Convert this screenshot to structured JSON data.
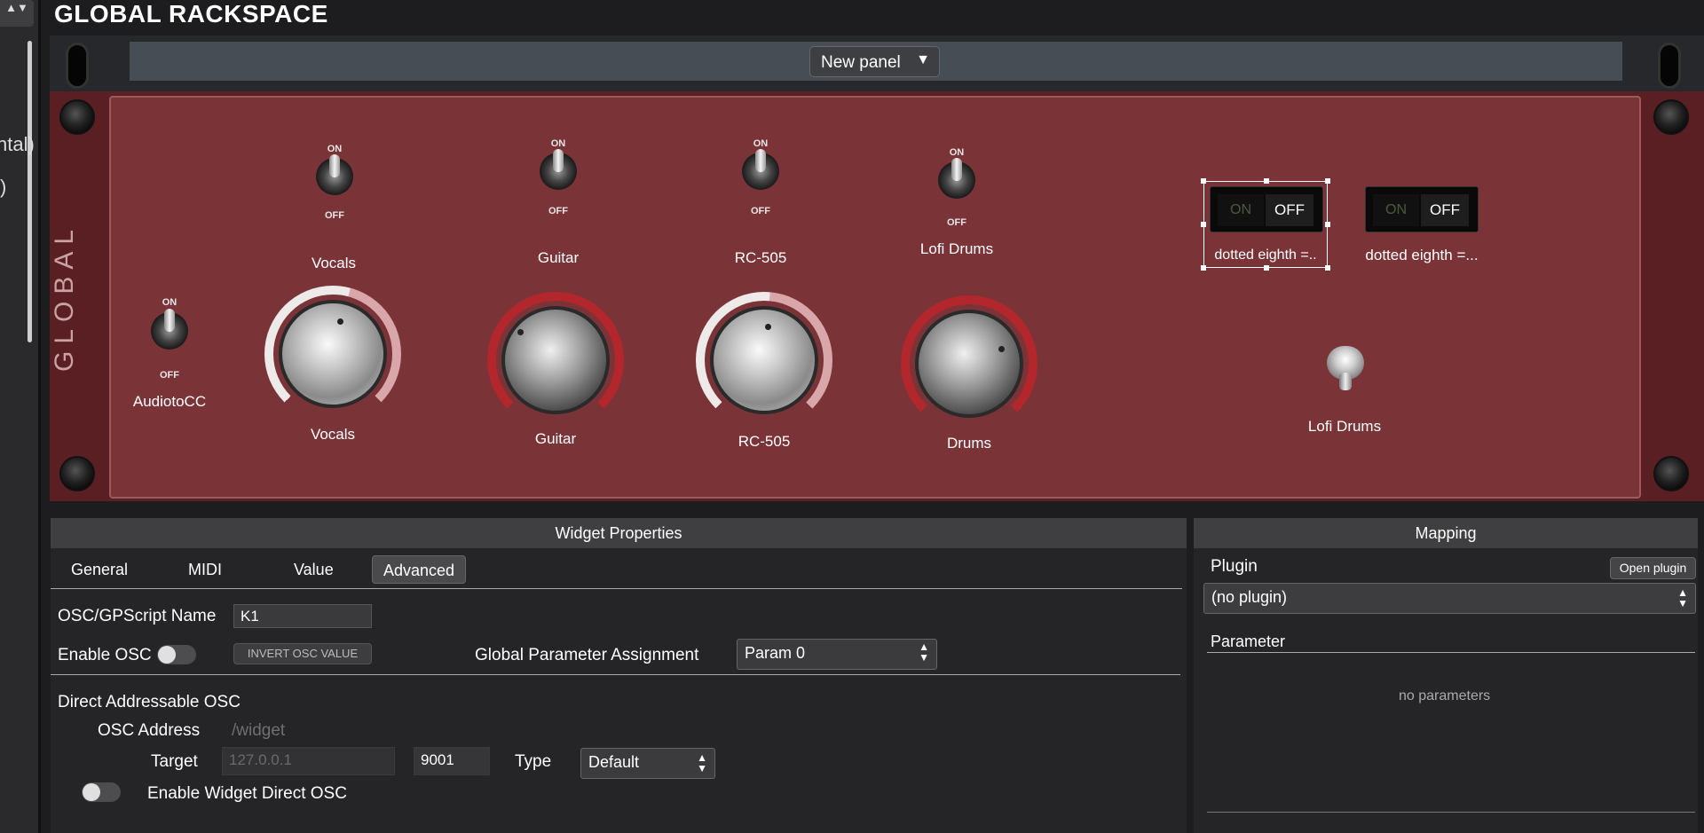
{
  "app_title": "GLOBAL RACKSPACE",
  "sidebar": {
    "arrows": "▲▼",
    "text1": "ntal)",
    "text2": ")"
  },
  "panel_selector": {
    "value": "New panel",
    "arrow": "▼"
  },
  "rack": {
    "side_label": "GLOBAL",
    "toggle_on": "ON",
    "toggle_off": "OFF",
    "switches": [
      {
        "label": "Vocals"
      },
      {
        "label": "Guitar"
      },
      {
        "label": "RC-505"
      },
      {
        "label": "Lofi Drums"
      },
      {
        "label": "AudiotoCC"
      },
      {
        "label": "Lofi Drums"
      }
    ],
    "knobs": [
      {
        "label": "Vocals",
        "style": "white"
      },
      {
        "label": "Guitar",
        "style": "red"
      },
      {
        "label": "RC-505",
        "style": "white"
      },
      {
        "label": "Drums",
        "style": "red"
      }
    ],
    "rockers": [
      {
        "on": "ON",
        "off": "OFF",
        "label": "dotted eighth =..",
        "selected": true
      },
      {
        "on": "ON",
        "off": "OFF",
        "label": "dotted eighth =...",
        "selected": false
      }
    ],
    "colors": {
      "rack_face": "#7a3438",
      "ring_red": "#b3262b",
      "ring_white": "#e9e2e2"
    }
  },
  "widget_properties": {
    "title": "Widget Properties",
    "tabs": [
      {
        "label": "General",
        "active": false
      },
      {
        "label": "MIDI",
        "active": false
      },
      {
        "label": "Value",
        "active": false
      },
      {
        "label": "Advanced",
        "active": true
      }
    ],
    "osc_name_label": "OSC/GPScript Name",
    "osc_name_value": "K1",
    "enable_osc_label": "Enable OSC",
    "invert_osc_label": "INVERT OSC VALUE",
    "global_param_label": "Global Parameter Assignment",
    "global_param_value": "Param 0",
    "direct_osc_heading": "Direct Addressable OSC",
    "osc_address_label": "OSC Address",
    "osc_address_value": "/widget",
    "target_label": "Target",
    "target_ip": "127.0.0.1",
    "target_port": "9001",
    "type_label": "Type",
    "type_value": "Default",
    "enable_direct_label": "Enable Widget Direct OSC"
  },
  "mapping": {
    "title": "Mapping",
    "plugin_label": "Plugin",
    "open_plugin": "Open plugin",
    "plugin_value": "(no plugin)",
    "parameter_label": "Parameter",
    "no_params": "no parameters"
  }
}
